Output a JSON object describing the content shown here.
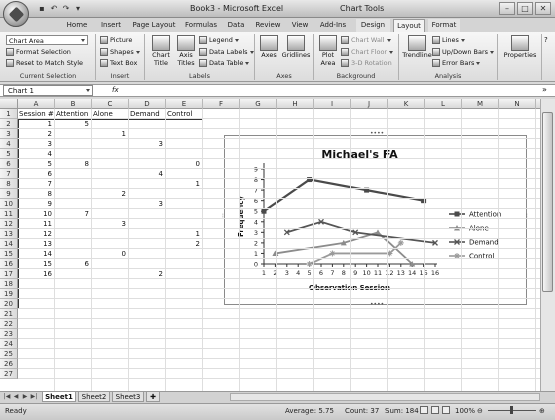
{
  "window": {
    "doc_title": "Book3 - Microsoft Excel",
    "contextual_title": "Chart Tools",
    "quick_access": [
      "save",
      "undo",
      "redo"
    ]
  },
  "ribbon_tabs": [
    "Home",
    "Insert",
    "Page Layout",
    "Formulas",
    "Data",
    "Review",
    "View",
    "Add-Ins",
    "Design",
    "Layout",
    "Format"
  ],
  "active_tab": "Layout",
  "ribbon": {
    "current_selection": {
      "dropdown_value": "Chart Area",
      "format_selection": "Format Selection",
      "reset_style": "Reset to Match Style",
      "label": "Current Selection"
    },
    "insert": {
      "picture": "Picture",
      "shapes": "Shapes",
      "text_box": "Text Box",
      "label": "Insert"
    },
    "labels": {
      "chart_title": [
        "Chart",
        "Title"
      ],
      "axis_titles": [
        "Axis",
        "Titles"
      ],
      "legend": "Legend",
      "data_labels": "Data Labels",
      "data_table": "Data Table",
      "label": "Labels"
    },
    "axes": {
      "axes": "Axes",
      "gridlines": "Gridlines",
      "label": "Axes"
    },
    "background": {
      "plot_area": [
        "Plot",
        "Area"
      ],
      "chart_wall": "Chart Wall",
      "chart_floor": "Chart Floor",
      "rotation": "3-D Rotation",
      "label": "Background"
    },
    "analysis": {
      "trendline": "Trendline",
      "lines": "Lines",
      "up_down_bars": "Up/Down Bars",
      "error_bars": "Error Bars",
      "label": "Analysis"
    },
    "properties": {
      "label": "Properties"
    }
  },
  "formula_bar": {
    "name_box": "Chart 1",
    "fx": "fx",
    "formula": ""
  },
  "sheet": {
    "columns": [
      "A",
      "B",
      "C",
      "D",
      "E",
      "F",
      "G",
      "H",
      "I",
      "J",
      "K",
      "L",
      "M",
      "N"
    ],
    "rows": [
      "1",
      "2",
      "3",
      "4",
      "5",
      "6",
      "7",
      "8",
      "9",
      "10",
      "11",
      "12",
      "13",
      "14",
      "15",
      "16",
      "17",
      "18",
      "19",
      "20",
      "21",
      "22",
      "23",
      "24",
      "25",
      "26",
      "27"
    ],
    "headers": [
      "Session #",
      "Attention",
      "Alone",
      "Demand",
      "Control"
    ],
    "data": [
      [
        "1",
        "5",
        "",
        "",
        ""
      ],
      [
        "2",
        "",
        "1",
        "",
        ""
      ],
      [
        "3",
        "",
        "",
        "3",
        ""
      ],
      [
        "4",
        "",
        "",
        "",
        ""
      ],
      [
        "5",
        "8",
        "",
        "",
        "0"
      ],
      [
        "6",
        "",
        "",
        "4",
        ""
      ],
      [
        "7",
        "",
        "",
        "",
        "1"
      ],
      [
        "8",
        "",
        "2",
        "",
        ""
      ],
      [
        "9",
        "",
        "",
        "3",
        ""
      ],
      [
        "10",
        "7",
        "",
        "",
        ""
      ],
      [
        "11",
        "",
        "3",
        "",
        ""
      ],
      [
        "12",
        "",
        "",
        "",
        "1"
      ],
      [
        "13",
        "",
        "",
        "",
        "2"
      ],
      [
        "14",
        "",
        "0",
        "",
        ""
      ],
      [
        "15",
        "6",
        "",
        "",
        ""
      ],
      [
        "16",
        "",
        "",
        "2",
        ""
      ]
    ]
  },
  "chart_data": {
    "type": "line",
    "title": "Michael's FA",
    "xlabel": "Observation Session",
    "ylabel": "Frequency",
    "x": [
      1,
      2,
      3,
      4,
      5,
      6,
      7,
      8,
      9,
      10,
      11,
      12,
      13,
      14,
      15,
      16
    ],
    "xlim": [
      1,
      16
    ],
    "ylim": [
      0,
      9
    ],
    "yticks": [
      0,
      1,
      2,
      3,
      4,
      5,
      6,
      7,
      8,
      9
    ],
    "legend_position": "right",
    "series": [
      {
        "name": "Attention",
        "color": "#4a4a4a",
        "marker": "square",
        "points": [
          [
            1,
            5
          ],
          [
            5,
            8
          ],
          [
            10,
            7
          ],
          [
            15,
            6
          ]
        ]
      },
      {
        "name": "Alone",
        "color": "#8c8c8c",
        "marker": "triangle",
        "points": [
          [
            2,
            1
          ],
          [
            8,
            2
          ],
          [
            11,
            3
          ],
          [
            14,
            0
          ]
        ]
      },
      {
        "name": "Demand",
        "color": "#555555",
        "marker": "x",
        "points": [
          [
            3,
            3
          ],
          [
            6,
            4
          ],
          [
            9,
            3
          ],
          [
            16,
            2
          ]
        ]
      },
      {
        "name": "Control",
        "color": "#9a9a9a",
        "marker": "asterisk",
        "points": [
          [
            5,
            0
          ],
          [
            7,
            1
          ],
          [
            12,
            1
          ],
          [
            13,
            2
          ]
        ]
      }
    ]
  },
  "sheet_tabs": [
    "Sheet1",
    "Sheet2",
    "Sheet3"
  ],
  "active_sheet": "Sheet1",
  "status": {
    "ready": "Ready",
    "average": "Average: 5.75",
    "count": "Count: 37",
    "sum": "Sum: 184",
    "zoom": "100%"
  }
}
